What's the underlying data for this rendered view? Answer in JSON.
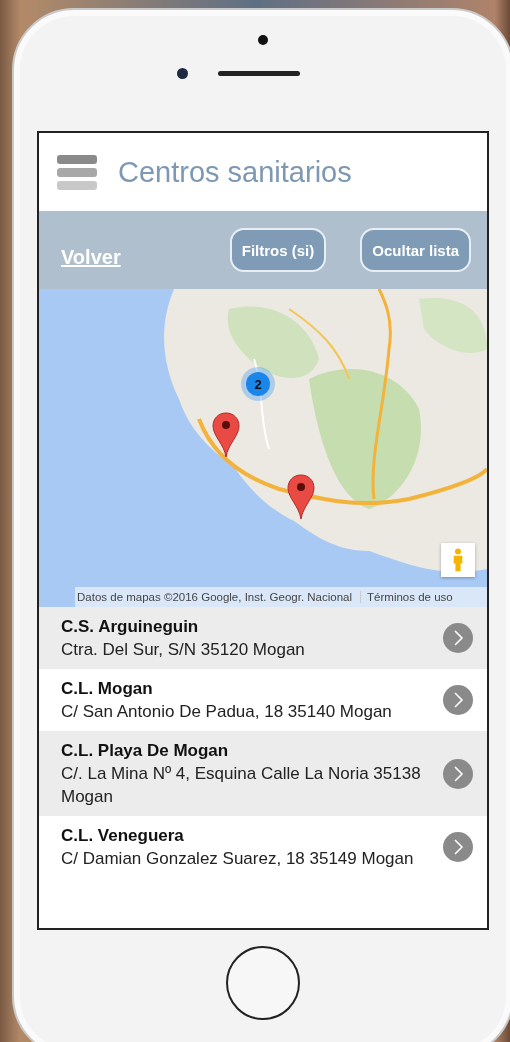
{
  "header": {
    "title": "Centros sanitarios"
  },
  "toolbar": {
    "back_link": "Volver",
    "buttons": [
      "Filtros (si)",
      "Ocultar lista"
    ]
  },
  "map": {
    "cluster_count": "2",
    "attribution": "Datos de mapas ©2016 Google, Inst. Geogr. Nacional",
    "terms_link": "Términos de uso"
  },
  "centers": [
    {
      "name": "C.S. Arguineguin",
      "address": "Ctra. Del Sur, S/N 35120 Mogan"
    },
    {
      "name": "C.L. Mogan",
      "address": "C/ San Antonio De Padua, 18 35140 Mogan"
    },
    {
      "name": "C.L. Playa De Mogan",
      "address": "C/. La Mina Nº 4, Esquina Calle La Noria 35138 Mogan"
    },
    {
      "name": "C.L. Veneguera",
      "address": "C/ Damian Gonzalez Suarez, 18 35149 Mogan"
    }
  ]
}
